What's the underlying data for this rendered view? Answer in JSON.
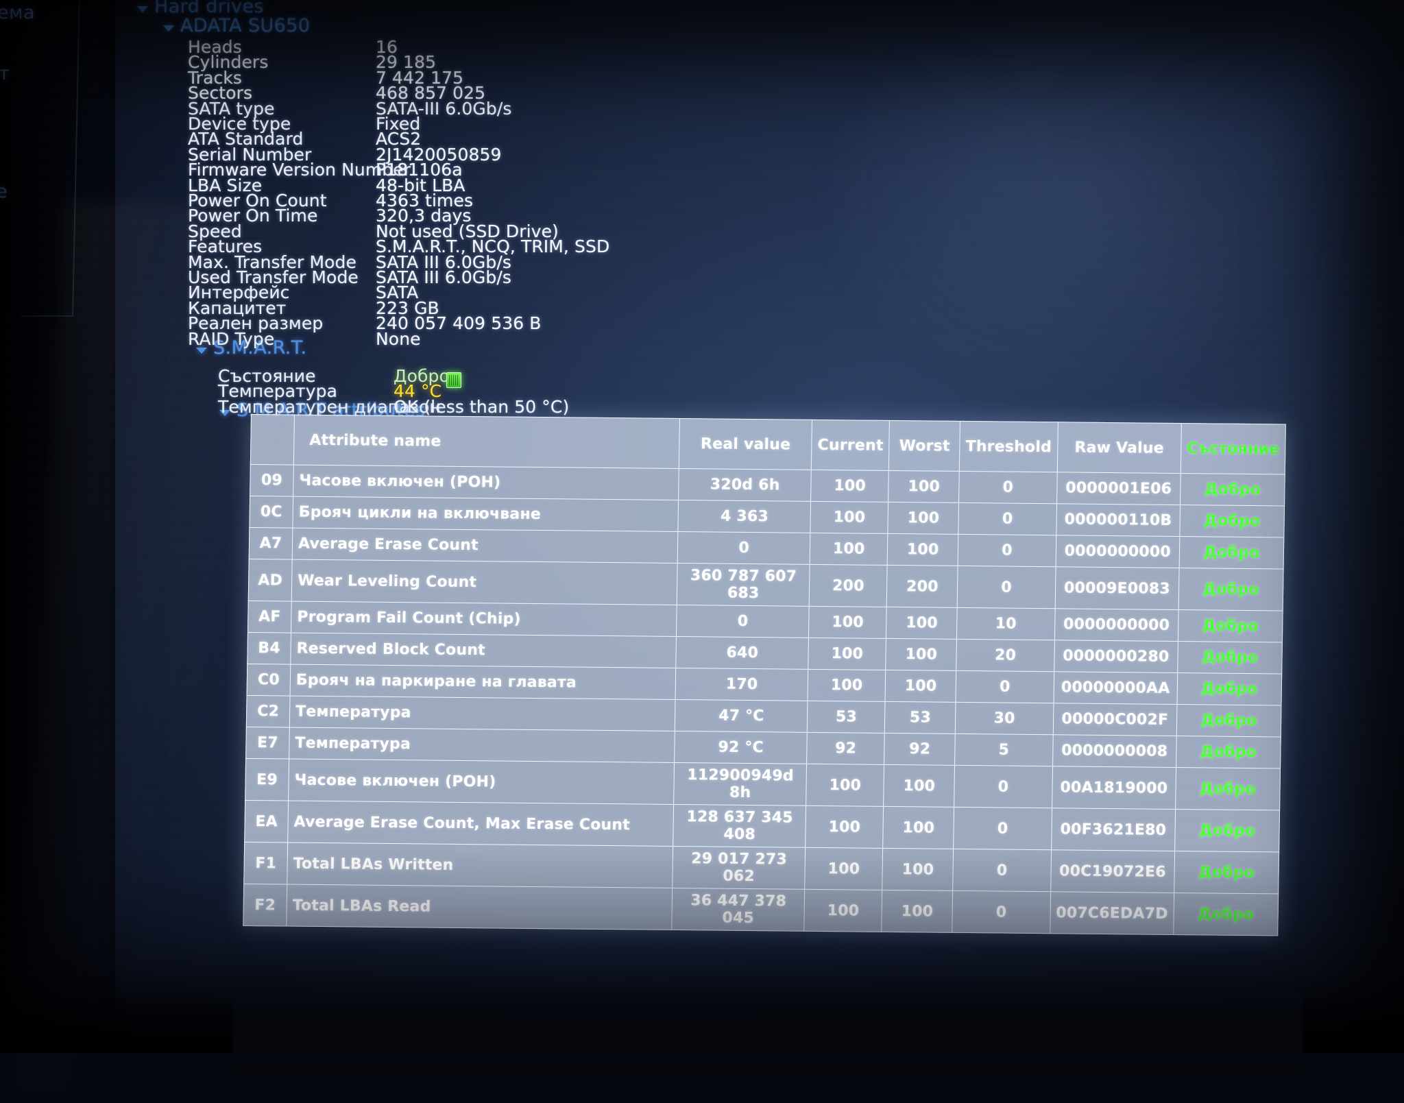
{
  "app": {
    "sidebar_fragments": [
      "ема",
      "т",
      "е"
    ]
  },
  "tree": {
    "hard_drives": "Hard drives",
    "device": "ADATA SU650",
    "smart": "S.M.A.R.T.",
    "smart_attributes": "S.M.A.R.T attributes"
  },
  "properties": [
    {
      "key": "Heads",
      "value": "16"
    },
    {
      "key": "Cylinders",
      "value": "29 185"
    },
    {
      "key": "Tracks",
      "value": "7 442 175"
    },
    {
      "key": "Sectors",
      "value": "468 857 025"
    },
    {
      "key": "SATA type",
      "value": "SATA-III 6.0Gb/s"
    },
    {
      "key": "Device type",
      "value": "Fixed"
    },
    {
      "key": "ATA Standard",
      "value": "ACS2"
    },
    {
      "key": "Serial Number",
      "value": "2J1420050859"
    },
    {
      "key": "Firmware Version Number",
      "value": "P181106a"
    },
    {
      "key": "LBA Size",
      "value": "48-bit LBA"
    },
    {
      "key": "Power On Count",
      "value": "4363 times"
    },
    {
      "key": "Power On Time",
      "value": "320,3 days"
    },
    {
      "key": "Speed",
      "value": "Not used (SSD Drive)"
    },
    {
      "key": "Features",
      "value": "S.M.A.R.T., NCQ, TRIM, SSD"
    },
    {
      "key": "Max. Transfer Mode",
      "value": "SATA III 6.0Gb/s"
    },
    {
      "key": "Used Transfer Mode",
      "value": "SATA III 6.0Gb/s"
    },
    {
      "key": "Интерфейс",
      "value": "SATA"
    },
    {
      "key": "Капацитет",
      "value": "223 GB"
    },
    {
      "key": "Реален размер",
      "value": "240 057 409 536 B"
    },
    {
      "key": "RAID Type",
      "value": "None"
    }
  ],
  "smart_status": [
    {
      "key": "Състояние",
      "value": "Добро",
      "style": "ok"
    },
    {
      "key": "Температура",
      "value": "44 °C",
      "style": "warm"
    },
    {
      "key": "Температурен диапазон",
      "value": "OK (less than 50 °C)",
      "style": "plain"
    }
  ],
  "smart_table": {
    "headers": [
      "",
      "Attribute name",
      "Real value",
      "Current",
      "Worst",
      "Threshold",
      "Raw Value",
      "Състояние"
    ],
    "rows": [
      {
        "id": "09",
        "name": "Часове включен (POH)",
        "real": "320d 6h",
        "current": "100",
        "worst": "100",
        "threshold": "0",
        "raw": "0000001E06",
        "status": "Добро"
      },
      {
        "id": "0C",
        "name": "Брояч цикли на включване",
        "real": "4 363",
        "current": "100",
        "worst": "100",
        "threshold": "0",
        "raw": "000000110B",
        "status": "Добро"
      },
      {
        "id": "A7",
        "name": "Average Erase Count",
        "real": "0",
        "current": "100",
        "worst": "100",
        "threshold": "0",
        "raw": "0000000000",
        "status": "Добро"
      },
      {
        "id": "AD",
        "name": "Wear Leveling Count",
        "real": "360 787 607 683",
        "current": "200",
        "worst": "200",
        "threshold": "0",
        "raw": "00009E0083",
        "status": "Добро"
      },
      {
        "id": "AF",
        "name": "Program Fail Count (Chip)",
        "real": "0",
        "current": "100",
        "worst": "100",
        "threshold": "10",
        "raw": "0000000000",
        "status": "Добро"
      },
      {
        "id": "B4",
        "name": "Reserved Block Count",
        "real": "640",
        "current": "100",
        "worst": "100",
        "threshold": "20",
        "raw": "0000000280",
        "status": "Добро"
      },
      {
        "id": "C0",
        "name": "Брояч на паркиране на главата",
        "real": "170",
        "current": "100",
        "worst": "100",
        "threshold": "0",
        "raw": "00000000AA",
        "status": "Добро"
      },
      {
        "id": "C2",
        "name": "Температура",
        "real": "47 °C",
        "current": "53",
        "worst": "53",
        "threshold": "30",
        "raw": "00000C002F",
        "status": "Добро"
      },
      {
        "id": "E7",
        "name": "Температура",
        "real": "92 °C",
        "current": "92",
        "worst": "92",
        "threshold": "5",
        "raw": "0000000008",
        "status": "Добро"
      },
      {
        "id": "E9",
        "name": "Часове включен (POH)",
        "real": "112900949d 8h",
        "current": "100",
        "worst": "100",
        "threshold": "0",
        "raw": "00A1819000",
        "status": "Добро"
      },
      {
        "id": "EA",
        "name": "Average Erase Count, Max Erase Count",
        "real": "128 637 345 408",
        "current": "100",
        "worst": "100",
        "threshold": "0",
        "raw": "00F3621E80",
        "status": "Добро"
      },
      {
        "id": "F1",
        "name": "Total LBAs Written",
        "real": "29 017 273 062",
        "current": "100",
        "worst": "100",
        "threshold": "0",
        "raw": "00C19072E6",
        "status": "Добро"
      },
      {
        "id": "F2",
        "name": "Total LBAs Read",
        "real": "36 447 378 045",
        "current": "100",
        "worst": "100",
        "threshold": "0",
        "raw": "007C6EDA7D",
        "status": "Добро"
      }
    ]
  },
  "colors": {
    "tree_link": "#4d8fe0",
    "text": "#f2f5fa",
    "status_good": "#4dff3a",
    "temp_warn": "#ffe22a"
  }
}
